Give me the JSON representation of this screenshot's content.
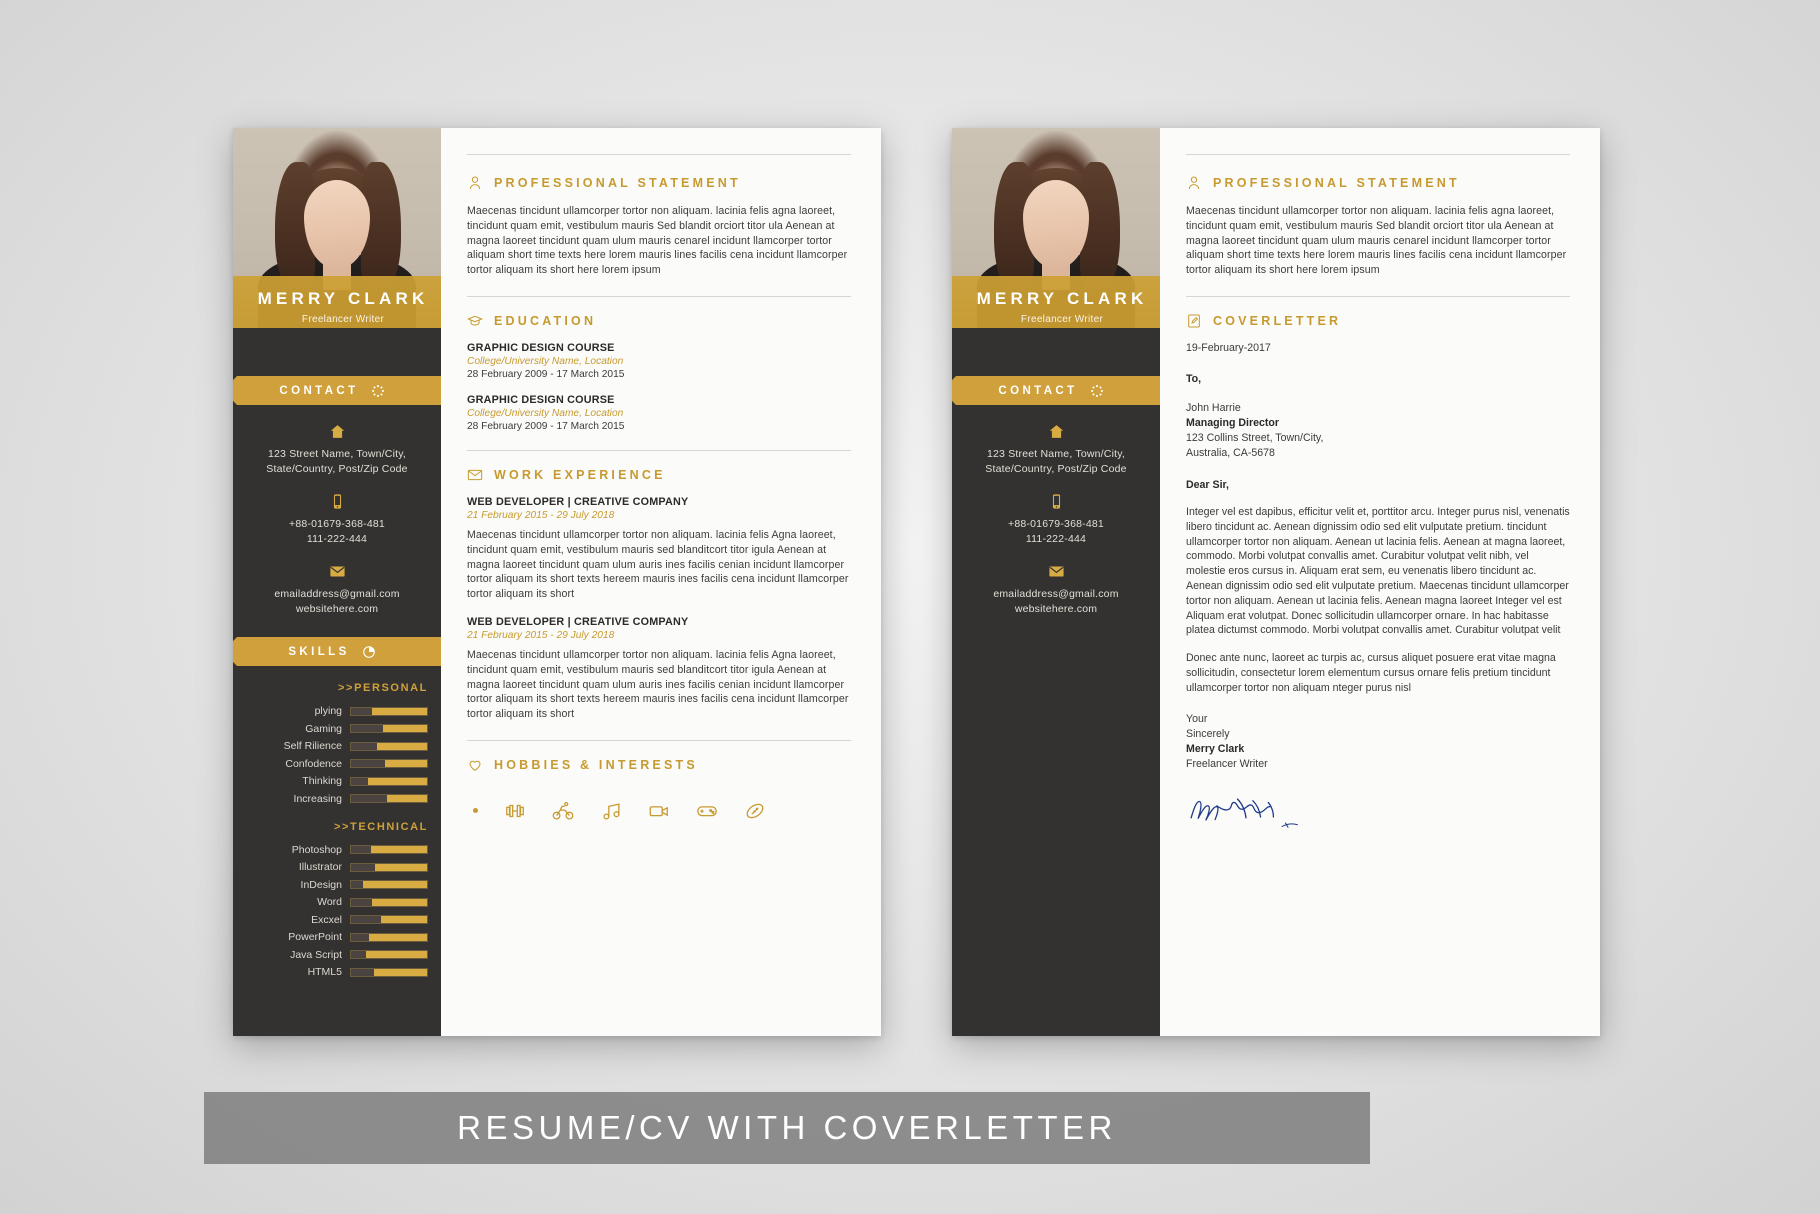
{
  "caption": "RESUME/CV WITH COVERLETTER",
  "profile": {
    "name": "MERRY CLARK",
    "role": "Freelancer Writer"
  },
  "sidebar": {
    "contact_ribbon": "CONTACT",
    "skills_ribbon": "SKILLS",
    "contact": {
      "address_line1": "123 Street Name, Town/City,",
      "address_line2": "State/Country, Post/Zip Code",
      "phone1": "+88-01679-368-481",
      "phone2": "111-222-444",
      "email": "emailaddress@gmail.com",
      "website": "websitehere.com"
    },
    "skills": {
      "personal_title": ">>PERSONAL",
      "technical_title": ">>TECHNICAL",
      "personal": [
        {
          "label": "plying",
          "value": 72
        },
        {
          "label": "Gaming",
          "value": 58
        },
        {
          "label": "Self Rilience",
          "value": 66
        },
        {
          "label": "Confodence",
          "value": 55
        },
        {
          "label": "Thinking",
          "value": 78
        },
        {
          "label": "Increasing",
          "value": 52
        }
      ],
      "technical": [
        {
          "label": "Photoshop",
          "value": 74
        },
        {
          "label": "Illustrator",
          "value": 68
        },
        {
          "label": "InDesign",
          "value": 84
        },
        {
          "label": "Word",
          "value": 72
        },
        {
          "label": "Excxel",
          "value": 60
        },
        {
          "label": "PowerPoint",
          "value": 76
        },
        {
          "label": "Java Script",
          "value": 80
        },
        {
          "label": "HTML5",
          "value": 70
        }
      ]
    }
  },
  "resume": {
    "statement": {
      "title": "PROFESSIONAL STATEMENT",
      "body": "Maecenas tincidunt ullamcorper tortor non aliquam. lacinia felis agna laoreet, tincidunt quam emit, vestibulum mauris Sed blandit orciort titor ula Aenean at magna laoreet tincidunt quam ulum mauris cenarel incidunt llamcorper tortor aliquam short time texts here lorem mauris lines facilis cena incidunt llamcorper tortor aliquam its short here lorem ipsum"
    },
    "education": {
      "title": "EDUCATION",
      "entries": [
        {
          "title": "GRAPHIC DESIGN COURSE",
          "sub": "College/University Name, Location",
          "date": "28 February 2009 - 17 March 2015"
        },
        {
          "title": "GRAPHIC DESIGN COURSE",
          "sub": "College/University Name, Location",
          "date": "28 February 2009 - 17 March 2015"
        }
      ]
    },
    "experience": {
      "title": "WORK EXPERIENCE",
      "entries": [
        {
          "title": "WEB DEVELOPER | CREATIVE COMPANY",
          "date": "21 February 2015 - 29 July 2018",
          "body": "Maecenas tincidunt ullamcorper tortor non aliquam. lacinia felis Agna laoreet, tincidunt quam emit, vestibulum mauris sed blanditcort titor igula Aenean at magna laoreet tincidunt quam ulum auris ines facilis cenian incidunt llamcorper tortor aliquam its short texts hereem mauris ines facilis cena incidunt llamcorper tortor aliquam its short"
        },
        {
          "title": "WEB DEVELOPER | CREATIVE COMPANY",
          "date": "21 February 2015 - 29 July 2018",
          "body": "Maecenas tincidunt ullamcorper tortor non aliquam. lacinia felis Agna laoreet, tincidunt quam emit, vestibulum mauris sed blanditcort titor igula Aenean at magna laoreet tincidunt quam ulum auris ines facilis cenian incidunt llamcorper tortor aliquam its short texts hereem mauris ines facilis cena incidunt llamcorper tortor aliquam its short"
        }
      ]
    },
    "hobbies": {
      "title": "HOBBIES & INTERESTS",
      "icons": [
        "dumbbell-icon",
        "cycling-icon",
        "music-note-icon",
        "video-camera-icon",
        "gamepad-icon",
        "football-icon"
      ]
    }
  },
  "coverletter": {
    "statement": {
      "title": "PROFESSIONAL STATEMENT",
      "body": "Maecenas tincidunt ullamcorper tortor non aliquam. lacinia felis agna laoreet, tincidunt quam emit, vestibulum mauris Sed blandit orciort titor ula Aenean at magna laoreet tincidunt quam ulum mauris cenarel incidunt llamcorper tortor aliquam short time texts here lorem mauris lines facilis cena incidunt llamcorper tortor aliquam its short here lorem ipsum"
    },
    "title": "COVERLETTER",
    "date": "19-February-2017",
    "to_label": "To,",
    "recipient": {
      "name": "John Harrie",
      "position": "Managing Director",
      "address1": "123 Collins Street, Town/City,",
      "address2": "Australia, CA-5678"
    },
    "salutation": "Dear Sir,",
    "paragraphs": [
      "Integer vel est dapibus, efficitur velit et, porttitor arcu. Integer purus nisl, venenatis libero tincidunt ac. Aenean dignissim odio sed elit vulputate pretium. tincidunt ullamcorper tortor non aliquam. Aenean ut lacinia felis. Aenean at magna laoreet, commodo. Morbi volutpat convallis amet. Curabitur volutpat velit nibh, vel molestie eros cursus in. Aliquam erat sem, eu venenatis libero tincidunt ac. Aenean dignissim odio sed elit vulputate pretium. Maecenas tincidunt ullamcorper tortor non aliquam. Aenean ut lacinia felis. Aenean magna laoreet Integer vel est Aliquam erat volutpat. Donec sollicitudin ullamcorper ornare. In hac habitasse platea dictumst commodo. Morbi volutpat convallis amet. Curabitur volutpat velit",
      "Donec ante nunc, laoreet ac turpis ac, cursus aliquet posuere erat vitae magna sollicitudin, consectetur lorem elementum cursus ornare felis pretium tincidunt ullamcorper tortor non aliquam nteger purus nisl"
    ],
    "closing": {
      "line1": "Your",
      "line2": "Sincerely",
      "name": "Merry Clark",
      "role": "Freelancer Writer"
    }
  }
}
